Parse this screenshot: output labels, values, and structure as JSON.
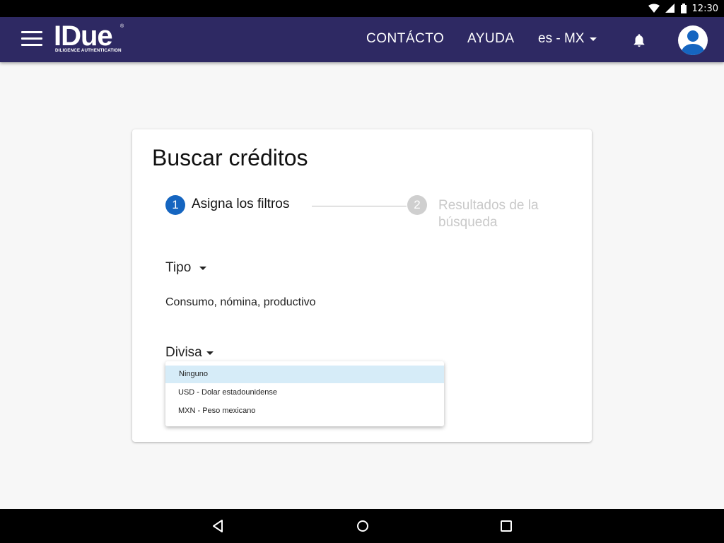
{
  "status_bar": {
    "time": "12:30",
    "icons": [
      "wifi-icon",
      "signal-icon",
      "battery-icon"
    ]
  },
  "app_bar": {
    "logo": {
      "text": "IDue",
      "registered": "®",
      "tagline": "DILIGENCE AUTHENTICATION"
    },
    "nav": {
      "contacto": "CONTÁCTO",
      "ayuda": "AYUDA"
    },
    "language": "es - MX",
    "icons": [
      "menu-icon",
      "bell-icon",
      "avatar-icon"
    ],
    "colors": {
      "background": "#2e2963"
    }
  },
  "card": {
    "title": "Buscar créditos",
    "steps": [
      {
        "number": "1",
        "label": "Asigna los filtros",
        "active": true
      },
      {
        "number": "2",
        "label": "Resultados de la búsqueda",
        "active": false
      }
    ],
    "fields": {
      "tipo": {
        "label": "Tipo",
        "value": "Consumo, nómina, productivo"
      },
      "divisa": {
        "label": "Divisa",
        "options": [
          {
            "label": "Ninguno",
            "selected": true
          },
          {
            "label": "USD - Dolar estadounidense",
            "selected": false
          },
          {
            "label": "MXN - Peso mexicano",
            "selected": false
          }
        ]
      }
    },
    "colors": {
      "active_step": "#1565c0",
      "inactive_step": "#cfcfcf",
      "selected_option": "#d6ecf8"
    }
  },
  "nav_bar": {
    "buttons": [
      "back-icon",
      "home-icon",
      "recents-icon"
    ]
  }
}
